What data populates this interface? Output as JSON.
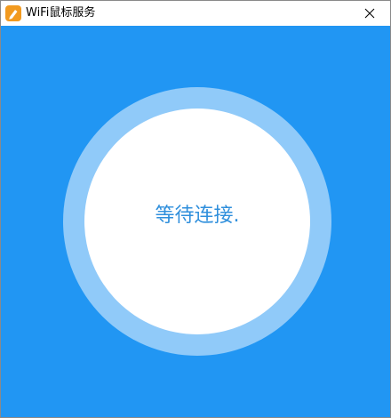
{
  "window": {
    "title": "WiFi鼠标服务",
    "app_icon": "pen-icon",
    "close_icon": "close-icon"
  },
  "main": {
    "status": "等待连接."
  },
  "colors": {
    "background": "#2196f3",
    "ring": "#90caf9",
    "inner": "#ffffff",
    "status_text": "#2f8fdc",
    "app_icon": "#f29a1f"
  }
}
